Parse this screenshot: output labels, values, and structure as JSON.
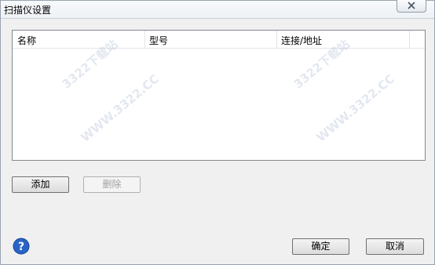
{
  "window": {
    "title": "扫描仪设置"
  },
  "icons": {
    "close": "close-icon",
    "help": "help-icon"
  },
  "list": {
    "columns": [
      "名称",
      "型号",
      "连接/地址"
    ],
    "rows": []
  },
  "buttons": {
    "add": "添加",
    "delete": "删除",
    "ok": "确定",
    "cancel": "取消"
  },
  "watermark": {
    "site": "3322下载站",
    "url": "WWW.3322.CC"
  },
  "colors": {
    "help_blue": "#2a63c7",
    "disabled_text": "#a0a0a0"
  }
}
